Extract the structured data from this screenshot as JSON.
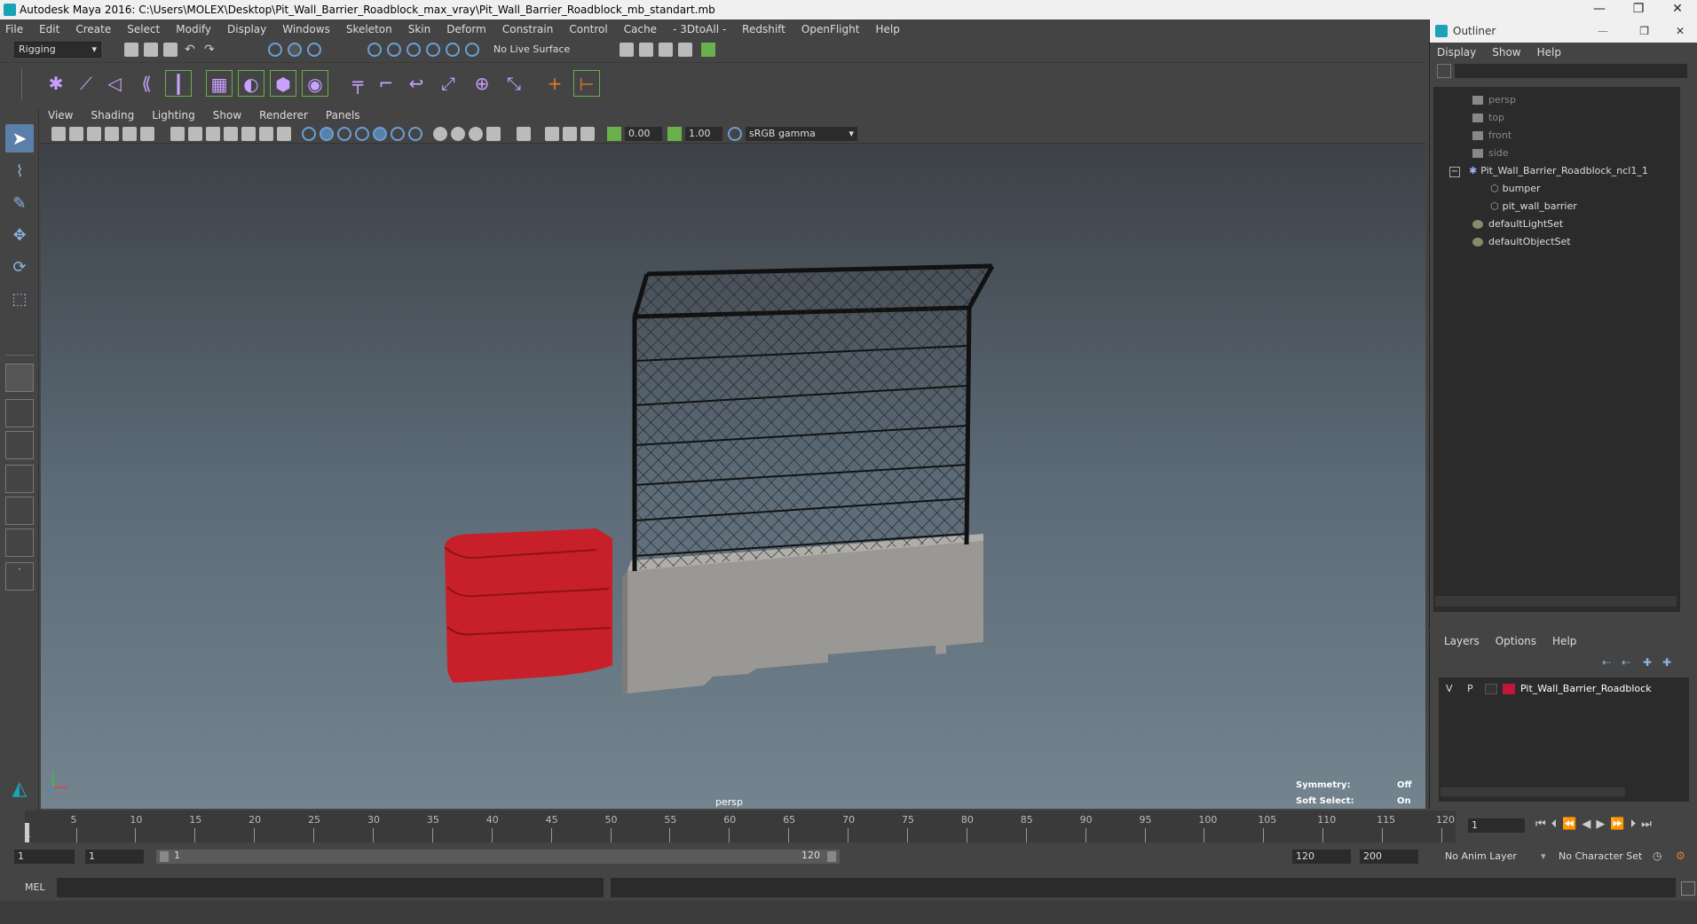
{
  "window": {
    "title": "Autodesk Maya 2016: C:\\Users\\MOLEX\\Desktop\\Pit_Wall_Barrier_Roadblock_max_vray\\Pit_Wall_Barrier_Roadblock_mb_standart.mb",
    "minimize": "—",
    "restore": "❐",
    "close": "✕"
  },
  "menubar": [
    "File",
    "Edit",
    "Create",
    "Select",
    "Modify",
    "Display",
    "Windows",
    "Skeleton",
    "Skin",
    "Deform",
    "Constrain",
    "Control",
    "Cache",
    "- 3DtoAll -",
    "Redshift",
    "OpenFlight",
    "Help"
  ],
  "statusline": {
    "menuset": "Rigging",
    "live_surface": "No Live Surface"
  },
  "panel": {
    "menus": [
      "View",
      "Shading",
      "Lighting",
      "Show",
      "Renderer",
      "Panels"
    ],
    "exposure": "0.00",
    "gamma": "1.00",
    "colorspace": "sRGB gamma",
    "camera_label": "persp",
    "symmetry_label": "Symmetry:",
    "symmetry_value": "Off",
    "softselect_label": "Soft Select:",
    "softselect_value": "On"
  },
  "outliner": {
    "title": "Outliner",
    "menus": [
      "Display",
      "Show",
      "Help"
    ],
    "items": [
      {
        "name": "persp",
        "type": "camera",
        "dim": true,
        "indent": 0
      },
      {
        "name": "top",
        "type": "camera",
        "dim": true,
        "indent": 0
      },
      {
        "name": "front",
        "type": "camera",
        "dim": true,
        "indent": 0
      },
      {
        "name": "side",
        "type": "camera",
        "dim": true,
        "indent": 0
      },
      {
        "name": "Pit_Wall_Barrier_Roadblock_ncl1_1",
        "type": "group",
        "dim": false,
        "indent": 0
      },
      {
        "name": "bumper",
        "type": "mesh",
        "dim": false,
        "indent": 1
      },
      {
        "name": "pit_wall_barrier",
        "type": "mesh",
        "dim": false,
        "indent": 1
      },
      {
        "name": "defaultLightSet",
        "type": "set",
        "dim": false,
        "indent": 0
      },
      {
        "name": "defaultObjectSet",
        "type": "set",
        "dim": false,
        "indent": 0
      }
    ]
  },
  "layers": {
    "menus": [
      "Layers",
      "Options",
      "Help"
    ],
    "rows": [
      {
        "v": "V",
        "p": "P",
        "color": "#c0173a",
        "name": "Pit_Wall_Barrier_Roadblock"
      }
    ]
  },
  "timeline": {
    "ticks": [
      5,
      10,
      15,
      20,
      25,
      30,
      35,
      40,
      45,
      50,
      55,
      60,
      65,
      70,
      75,
      80,
      85,
      90,
      95,
      100,
      105,
      110,
      115,
      120
    ],
    "first_tick": "1",
    "current_frame": "1"
  },
  "range": {
    "start": "1",
    "start2": "1",
    "slider_start": "1",
    "slider_end": "120",
    "end": "120",
    "end2": "200",
    "anim_layer": "No Anim Layer",
    "character_set": "No Character Set"
  },
  "cmdline": {
    "label": "MEL"
  }
}
